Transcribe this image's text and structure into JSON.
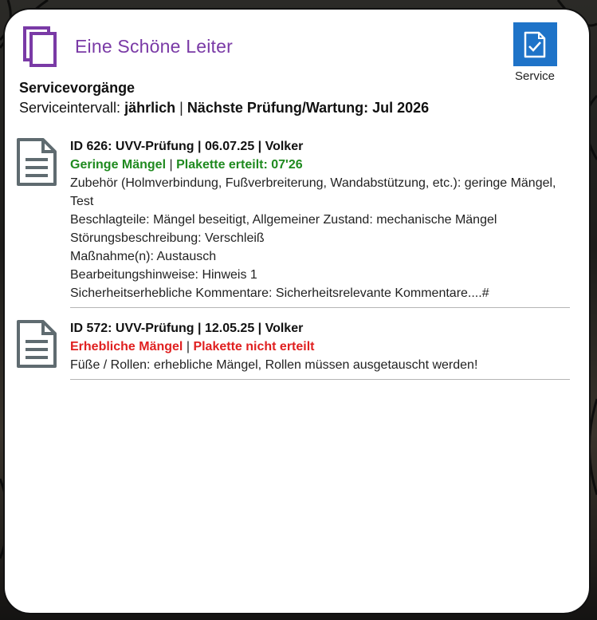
{
  "app": {
    "title": "Eine Schöne Leiter",
    "service_button_label": "Service"
  },
  "section": {
    "title": "Servicevorgänge",
    "interval_label": "Serviceintervall:",
    "interval_value": "jährlich",
    "divider": "|",
    "next_check": "Nächste Prüfung/Wartung: Jul 2026"
  },
  "entries": [
    {
      "title": "ID 626: UVV-Prüfung | 06.07.25 | Volker",
      "defects": "Geringe Mängel",
      "divider": "|",
      "badge": "Plakette erteilt: 07'26",
      "status_color": "#1f8a1f",
      "details": [
        "Zubehör (Holmverbindung, Fußverbreiterung, Wandabstützung, etc.): geringe Mängel, Test",
        "Beschlagteile: Mängel beseitigt, Allgemeiner Zustand: mechanische Mängel",
        "Störungsbeschreibung: Verschleiß",
        "Maßnahme(n): Austausch",
        "Bearbeitungshinweise: Hinweis 1",
        "Sicherheitserhebliche Kommentare: Sicherheitsrelevante Kommentare....#"
      ]
    },
    {
      "title": "ID 572: UVV-Prüfung | 12.05.25 | Volker",
      "defects": "Erhebliche Mängel",
      "divider": "|",
      "badge": "Plakette nicht erteilt",
      "status_color": "#e02020",
      "details": [
        "Füße / Rollen: erhebliche Mängel, Rollen müssen ausgetauscht werden!"
      ]
    }
  ],
  "icons": {
    "app": "copy-documents-icon",
    "service": "checklist-icon",
    "entry": "document-icon"
  },
  "colors": {
    "title": "#7a3aa6",
    "service_tile": "#1e73c8"
  }
}
